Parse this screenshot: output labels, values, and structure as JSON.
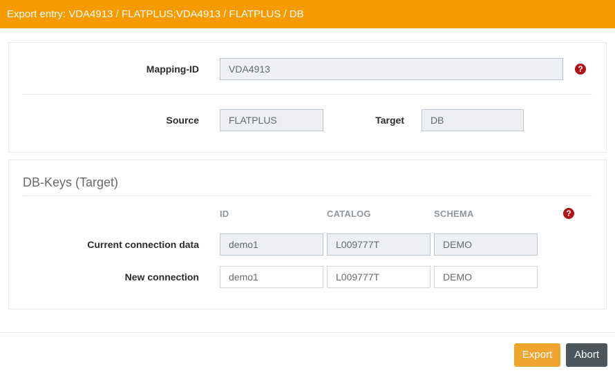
{
  "header": {
    "title": "Export entry: VDA4913 / FLATPLUS;VDA4913 / FLATPLUS / DB"
  },
  "mapping": {
    "label": "Mapping-ID",
    "value": "VDA4913",
    "source_label": "Source",
    "source_value": "FLATPLUS",
    "target_label": "Target",
    "target_value": "DB"
  },
  "db_keys": {
    "title": "DB-Keys (Target)",
    "columns": [
      "ID",
      "CATALOG",
      "SCHEMA"
    ],
    "rows": [
      {
        "label": "Current connection data",
        "readonly": true,
        "values": [
          "demo1",
          "L009777T",
          "DEMO"
        ]
      },
      {
        "label": "New connection",
        "readonly": false,
        "values": [
          "demo1",
          "L009777T",
          "DEMO"
        ]
      }
    ]
  },
  "footer": {
    "export_label": "Export",
    "abort_label": "Abort"
  },
  "icons": {
    "help_glyph": "?",
    "help_name": "question-circle"
  },
  "colors": {
    "header_bg": "#f59b00",
    "export_bg": "#f0a62e",
    "abort_bg": "#4b555e",
    "help_red": "#b11217",
    "panel_border": "#e7eaec"
  }
}
